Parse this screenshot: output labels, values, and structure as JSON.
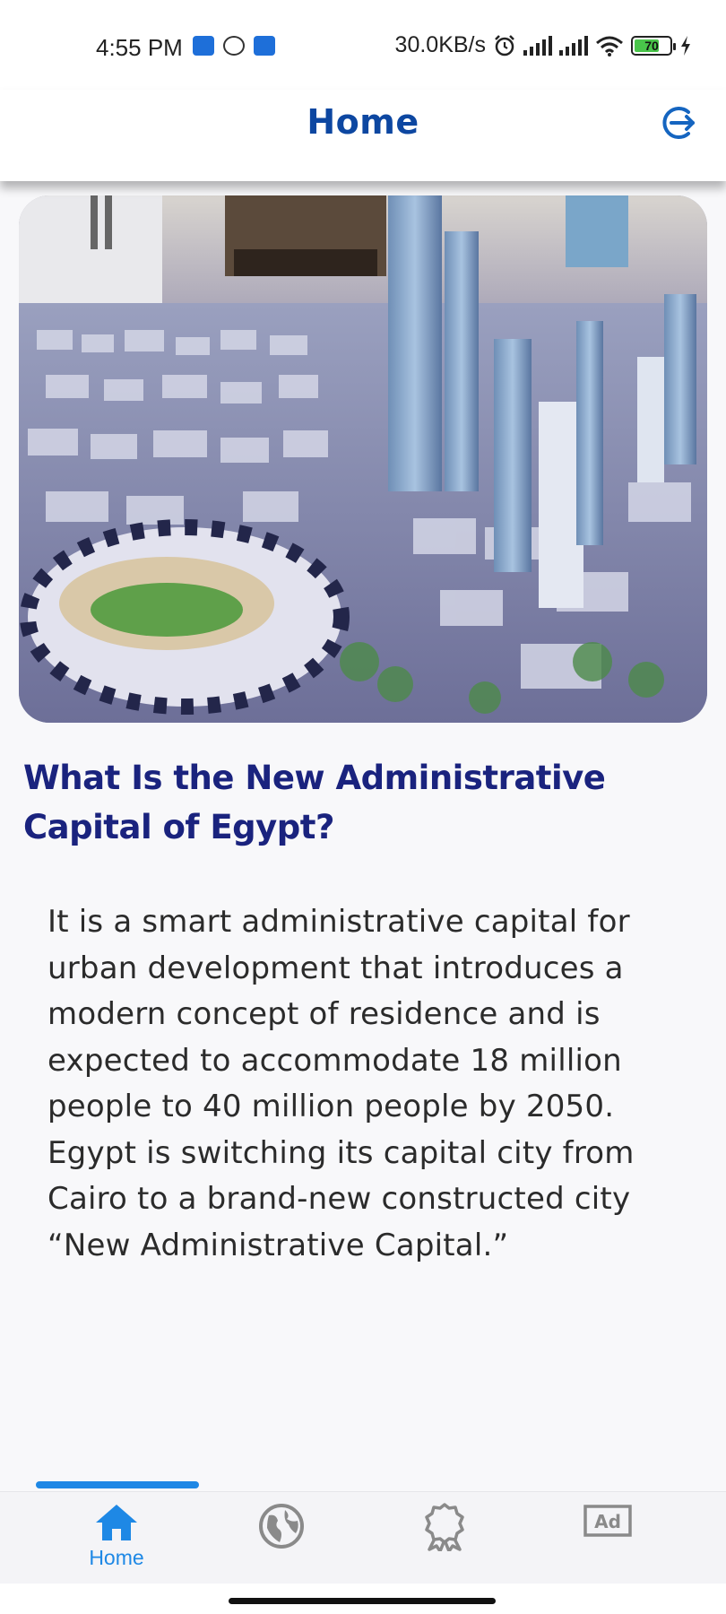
{
  "status_bar": {
    "time": "4:55 PM",
    "network_speed": "30.0KB/s",
    "battery_level": "70",
    "battery_fraction": 0.7,
    "icons": [
      "notification-icon",
      "app-notification-icon",
      "notification-icon",
      "alarm-icon",
      "signal-icon",
      "signal-icon",
      "wifi-icon",
      "battery-icon",
      "charging-icon"
    ]
  },
  "app_bar": {
    "title": "Home",
    "action_icon": "logout-icon"
  },
  "hero": {
    "image": "new-administrative-capital-city-model-photo"
  },
  "article": {
    "title": "What Is the New Administrative Capital of Egypt?",
    "body": "It is a smart administrative capital for urban development that introduces a modern concept of residence and is expected to accommodate 18 million people to 40 million people by 2050. Egypt is switching its capital city from Cairo to a brand-new constructed city “New Administrative Capital.”"
  },
  "bottom_nav": {
    "items": [
      {
        "label": "Home",
        "icon": "home-icon",
        "active": true
      },
      {
        "label": "",
        "icon": "globe-icon",
        "active": false
      },
      {
        "label": "",
        "icon": "award-icon",
        "active": false
      },
      {
        "label": "",
        "icon": "ad-icon",
        "active": false
      }
    ],
    "ad_icon_text": "Ad"
  },
  "colors": {
    "title_blue": "#0d47a1",
    "heading_navy": "#1a237e",
    "accent_blue": "#1e88e5",
    "inactive_icon": "#8a8a8a",
    "battery_green": "#49c54a"
  }
}
